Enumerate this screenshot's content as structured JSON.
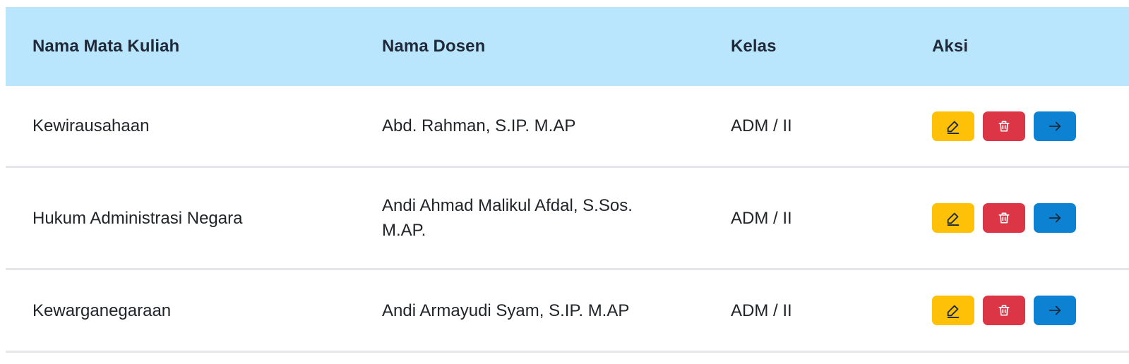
{
  "table": {
    "headers": {
      "course": "Nama Mata Kuliah",
      "lecturer": "Nama Dosen",
      "class": "Kelas",
      "action": "Aksi"
    },
    "rows": [
      {
        "course": "Kewirausahaan",
        "lecturer": "Abd. Rahman, S.IP. M.AP",
        "class": "ADM / II"
      },
      {
        "course": "Hukum Administrasi Negara",
        "lecturer": "Andi Ahmad Malikul Afdal, S.Sos. M.AP.",
        "class": "ADM / II"
      },
      {
        "course": "Kewarganegaraan",
        "lecturer": "Andi Armayudi Syam, S.IP. M.AP",
        "class": "ADM / II"
      }
    ],
    "actions": {
      "edit_icon": "pencil-icon",
      "delete_icon": "trash-icon",
      "open_icon": "arrow-right-icon"
    }
  },
  "colors": {
    "header_bg": "#bae6fd",
    "edit": "#ffc107",
    "delete": "#dc3545",
    "open": "#0d82d2",
    "divider": "#e5e7eb"
  }
}
